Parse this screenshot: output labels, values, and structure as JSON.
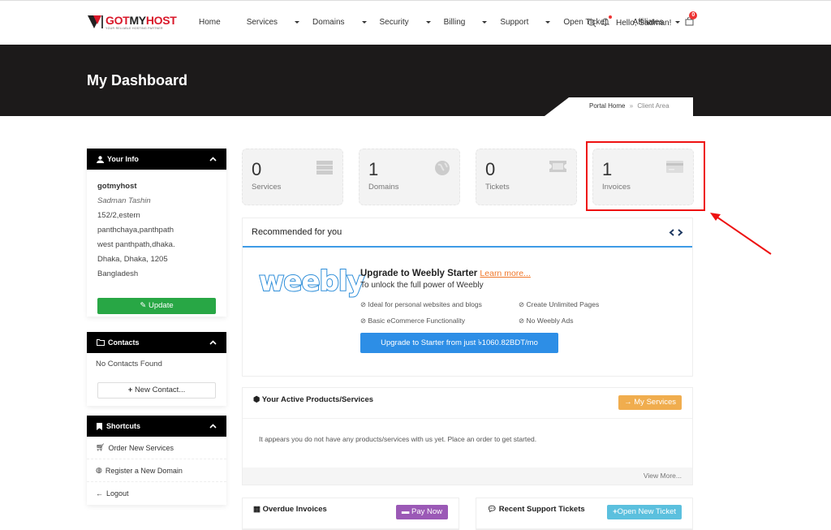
{
  "brand": {
    "name_red": "GOT",
    "name_dark": "MY",
    "name_red2": "HOST",
    "tagline": "YOUR RELIABLE HOSTING PARTNER"
  },
  "nav": {
    "items": [
      {
        "label": "Home",
        "dropdown": false
      },
      {
        "label": "Services",
        "dropdown": true
      },
      {
        "label": "Domains",
        "dropdown": true
      },
      {
        "label": "Security",
        "dropdown": true
      },
      {
        "label": "Billing",
        "dropdown": true
      },
      {
        "label": "Support",
        "dropdown": true
      },
      {
        "label": "Open Ticket",
        "dropdown": false
      },
      {
        "label": "Affiliates",
        "dropdown": false
      }
    ],
    "greeting": "Hello, Sadman!",
    "cart_count": "0"
  },
  "hero": {
    "title": "My Dashboard",
    "breadcrumb": {
      "home": "Portal Home",
      "sep": "»",
      "current": "Client Area"
    }
  },
  "your_info": {
    "title": "Your Info",
    "company": "gotmyhost",
    "name": "Sadman Tashin",
    "address_lines": [
      "152/2,estern",
      "panthchaya,panthpath",
      "west panthpath,dhaka.",
      "Dhaka, Dhaka, 1205",
      "Bangladesh"
    ],
    "update_label": "Update"
  },
  "contacts": {
    "title": "Contacts",
    "empty": "No Contacts Found",
    "new_label": "New Contact..."
  },
  "shortcuts": {
    "title": "Shortcuts",
    "items": [
      "Order New Services",
      "Register a New Domain",
      "Logout"
    ]
  },
  "stats": [
    {
      "value": "0",
      "label": "Services",
      "icon": "server-icon"
    },
    {
      "value": "1",
      "label": "Domains",
      "icon": "globe-icon"
    },
    {
      "value": "0",
      "label": "Tickets",
      "icon": "ticket-icon"
    },
    {
      "value": "1",
      "label": "Invoices",
      "icon": "credit-card-icon"
    }
  ],
  "recommended": {
    "title": "Recommended for you",
    "logo_text": "weebly",
    "headline": "Upgrade to Weebly Starter",
    "learn_more": "Learn more...",
    "subtitle": "To unlock the full power of Weebly",
    "features": [
      "Ideal for personal websites and blogs",
      "Create Unlimited Pages",
      "Basic eCommerce Functionality",
      "No Weebly Ads"
    ],
    "cta": "Upgrade to Starter from just ৳1060.82BDT/mo"
  },
  "active_products": {
    "title": "Your Active Products/Services",
    "button": "My Services",
    "empty": "It appears you do not have any products/services with us yet. Place an order to get started.",
    "view_more": "View More..."
  },
  "overdue": {
    "title": "Overdue Invoices",
    "button": "Pay Now"
  },
  "tickets": {
    "title": "Recent Support Tickets",
    "button": "Open New Ticket"
  },
  "colors": {
    "brand_red": "#d9182a",
    "green": "#28a745",
    "blue": "#2d8ee6",
    "orange": "#f0ad4e",
    "purple": "#9b59b6",
    "cyan": "#5bc0de",
    "highlight": "#ee1111"
  }
}
